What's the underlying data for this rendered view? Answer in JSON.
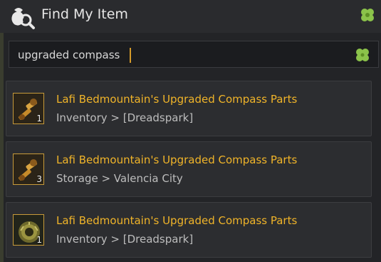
{
  "window": {
    "title": "Find My Item"
  },
  "icons": {
    "app": "money-bag-magnifier-icon",
    "top_right": "four-leaf-clover-icon",
    "search": "four-leaf-clover-icon"
  },
  "search": {
    "value": "upgraded compass"
  },
  "results": [
    {
      "name": "Lafi Bedmountain's Upgraded Compass Parts",
      "location": "Inventory > [Dreadspark]",
      "qty": "1",
      "icon": "compass-parts-icon"
    },
    {
      "name": "Lafi Bedmountain's Upgraded Compass Parts",
      "location": "Storage > Valencia City",
      "qty": "3",
      "icon": "compass-parts-icon"
    },
    {
      "name": "Lafi Bedmountain's Upgraded Compass Parts",
      "location": "Inventory > [Dreadspark]",
      "qty": "1",
      "icon": "compass-ring-icon"
    }
  ],
  "colors": {
    "item_name": "#f0b429",
    "accent": "#d49a2a",
    "clover": "#8bc34a"
  }
}
